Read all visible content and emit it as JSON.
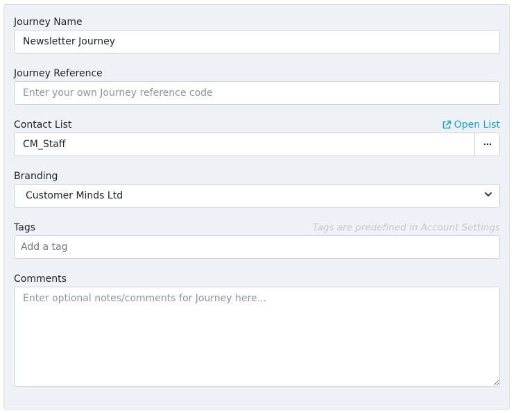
{
  "form": {
    "journey_name": {
      "label": "Journey Name",
      "value": "Newsletter Journey"
    },
    "journey_reference": {
      "label": "Journey Reference",
      "placeholder": "Enter your own Journey reference code"
    },
    "contact_list": {
      "label": "Contact List",
      "open_link": "Open List",
      "open_link_icon": "external-link-icon",
      "value": "CM_Staff",
      "more_button": "⋯"
    },
    "branding": {
      "label": "Branding",
      "selected": "Customer Minds Ltd"
    },
    "tags": {
      "label": "Tags",
      "hint": "Tags are predefined in Account Settings",
      "placeholder": "Add a tag"
    },
    "comments": {
      "label": "Comments",
      "placeholder": "Enter optional notes/comments for Journey here..."
    }
  },
  "colors": {
    "panel_bg": "#eef2f6",
    "link": "#17a2d8",
    "hint": "#c4c9ce"
  }
}
